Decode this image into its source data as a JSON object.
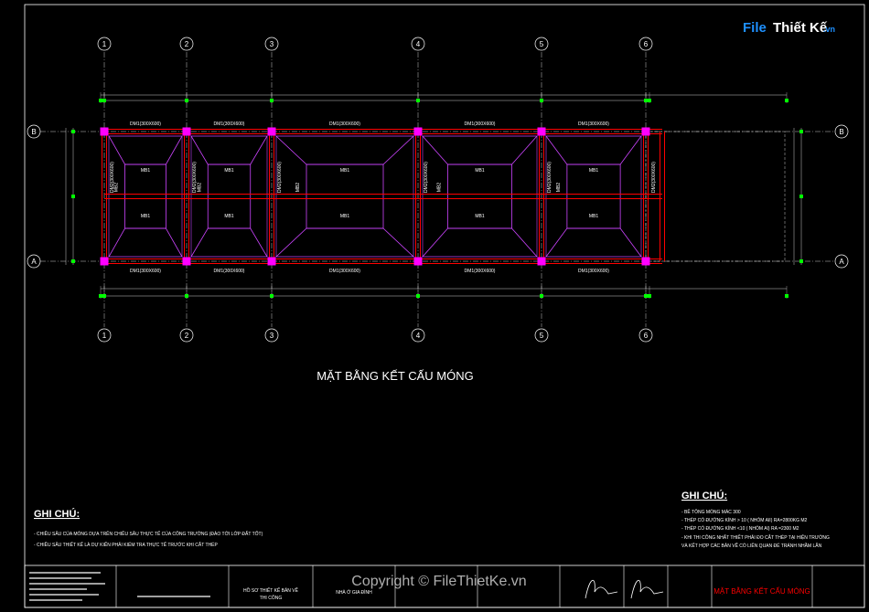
{
  "drawing": {
    "title": "MẶT BẰNG KẾT CẤU MÓNG",
    "grid_columns": [
      "1",
      "2",
      "3",
      "4",
      "5",
      "6"
    ],
    "grid_rows": [
      "B",
      "A"
    ],
    "beam_top": [
      "DM1(300X600)",
      "DM1(300X600)",
      "DM1(300X600)",
      "DM1(300X600)",
      "DM1(300X600)"
    ],
    "beam_bottom": [
      "DM1(300X600)",
      "DM1(300X600)",
      "DM1(300X600)",
      "DM1(300X600)",
      "DM1(300X600)"
    ],
    "beam_vertical": [
      "DM2(300X600)",
      "DM2(300X600)",
      "DM2(300X600)",
      "DM2(300X600)",
      "DM2(300X600)",
      "DM2(300X600)"
    ],
    "slab_label": "MB1",
    "slab_label_side": "MB2"
  },
  "notes_left": {
    "heading": "GHI CHÚ:",
    "lines": [
      "- CHIỀU SÂU CỦA MÓNG DỰA TRÊN CHIỀU SÂU THỰC TẾ CỦA CÔNG TRƯỜNG (ĐÀO TỚI LỚP ĐẤT TỐT)",
      "- CHIỀU SÂU THIẾT KẾ LÀ DỰ KIẾN PHẢI KIỂM TRA THỰC TẾ TRƯỚC KHI CẮT THÉP"
    ]
  },
  "notes_right": {
    "heading": "GHI CHÚ:",
    "lines": [
      "- BÊ TÔNG MÓNG MÁC 300",
      "- THÉP CÓ ĐƯỜNG KÍNH > 10 ( NHÓM AII) RA=2800KG M2",
      "- THÉP CÓ ĐƯỜNG KÍNH <10 ( NHÓM AI) RA =2300 M2",
      "- KHI THI CÔNG NHẤT THIẾT PHẢI ĐO CẮT THÉP TẠI HIỆN TRƯỜNG",
      "  VÀ KẾT HỢP CÁC BẢN VẼ CÓ LIÊN QUAN ĐỂ TRÁNH NHẦM LẪN"
    ]
  },
  "title_block": {
    "project_line1": "HỒ SƠ THIẾT KẾ BẢN VẼ",
    "project_line2": "THI CÔNG",
    "building": "NHÀ Ở GIA ĐÌNH",
    "sheet_title": "MẶT BẰNG KẾT CẤU MÓNG"
  },
  "watermark": "Copyright © FileThietKe.vn",
  "logo": {
    "part1": "File",
    "part2": "Thiết Kế",
    "suffix": ".vn"
  },
  "colors": {
    "background": "#000000",
    "beam": "#ff0000",
    "column": "#ff00ff",
    "slab": "#cc44ff",
    "dimension": "#00ff00",
    "grid_line": "#ffffff"
  }
}
